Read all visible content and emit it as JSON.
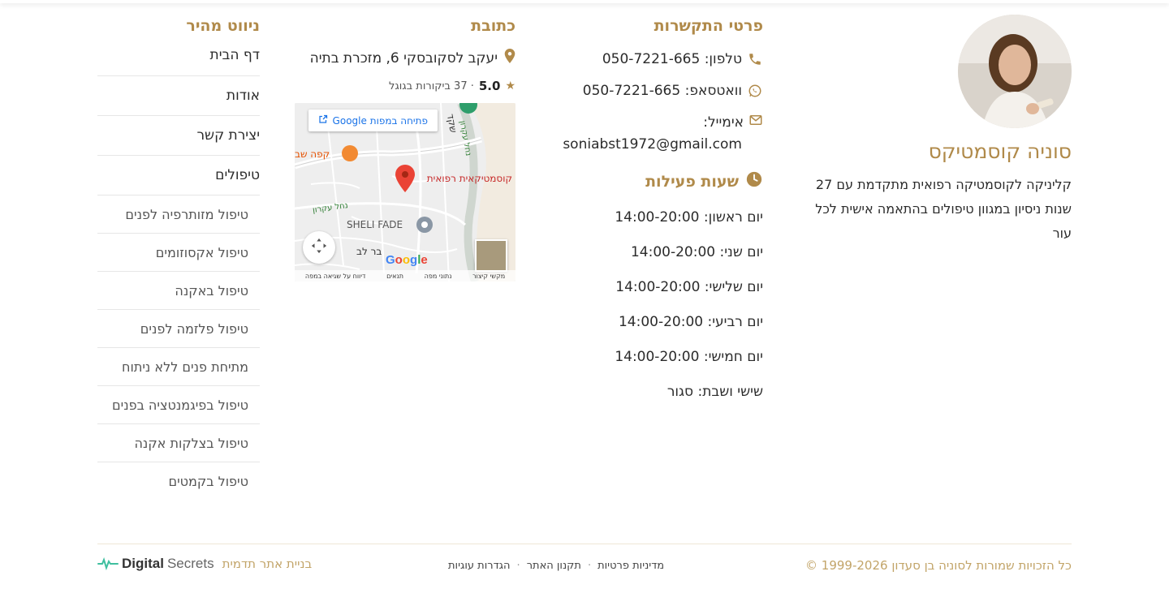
{
  "profile": {
    "name": "סוניה קוסמטיקס",
    "description": "קליניקה לקוסמטיקה רפואית מתקדמת עם 27 שנות ניסיון במגוון טיפולים בהתאמה אישית לכל עור"
  },
  "contact": {
    "title": "פרטי התקשרות",
    "phone_label": "טלפון: 050-7221-665",
    "whatsapp_label": "וואטסאפ: 050-7221-665",
    "email_label": "אימייל:",
    "email_value": "soniabst1972@gmail.com"
  },
  "hours": {
    "title": "שעות פעילות",
    "rows": [
      "יום ראשון: 14:00-20:00",
      "יום שני: 14:00-20:00",
      "יום שלישי: 14:00-20:00",
      "יום רביעי: 14:00-20:00",
      "יום חמישי: 14:00-20:00",
      "שישי ושבת: סגור"
    ]
  },
  "address": {
    "title": "כתובת",
    "street": "יעקב לסקובסקי 6, מזכרת בתיה",
    "rating_score": "5.0",
    "rating_text": "· 37 ביקורות בגוגל"
  },
  "map": {
    "open_in_maps": "פתיחה במפות Google",
    "place_label": "קוסמטיקאית רפואית",
    "cafe_label": "קפה שב",
    "sheli_label": "SHELI FADE",
    "street_label_1": "שקד",
    "street_label_2": "נחל עקרון",
    "street_label_3": "נחל עקרון",
    "street_label_4": "בר לב",
    "google_logo": "Google",
    "footer_links": [
      "מקשי קיצור",
      "נתוני מפה",
      "תנאים",
      "דיווח על שגיאה במפה"
    ]
  },
  "nav": {
    "title": "ניווט מהיר",
    "items": [
      "דף הבית",
      "אודות",
      "יצירת קשר",
      "טיפולים"
    ],
    "sub_items": [
      "טיפול מזותרפיה לפנים",
      "טיפול אקסוזומים",
      "טיפול באקנה",
      "טיפול פלזמה לפנים",
      "מתיחת פנים ללא ניתוח",
      "טיפול בפיגמנטציה בפנים",
      "טיפול בצלקות אקנה",
      "טיפול בקמטים"
    ]
  },
  "footer": {
    "copyright": "כל הזכויות שמורות לסוניה בן סעדון 1999-2026 ©",
    "links": [
      "מדיניות פרטיות",
      "תקנון האתר",
      "הגדרות עוגיות"
    ],
    "credit_text": "בניית אתר תדמית",
    "credit_logo_bold": "Digital",
    "credit_logo_light": "Secrets"
  },
  "colors": {
    "accent_gold": "#b08a4a",
    "light_gold": "#c2a468",
    "link_blue": "#1a73e8",
    "map_pin_red": "#ea4335"
  }
}
